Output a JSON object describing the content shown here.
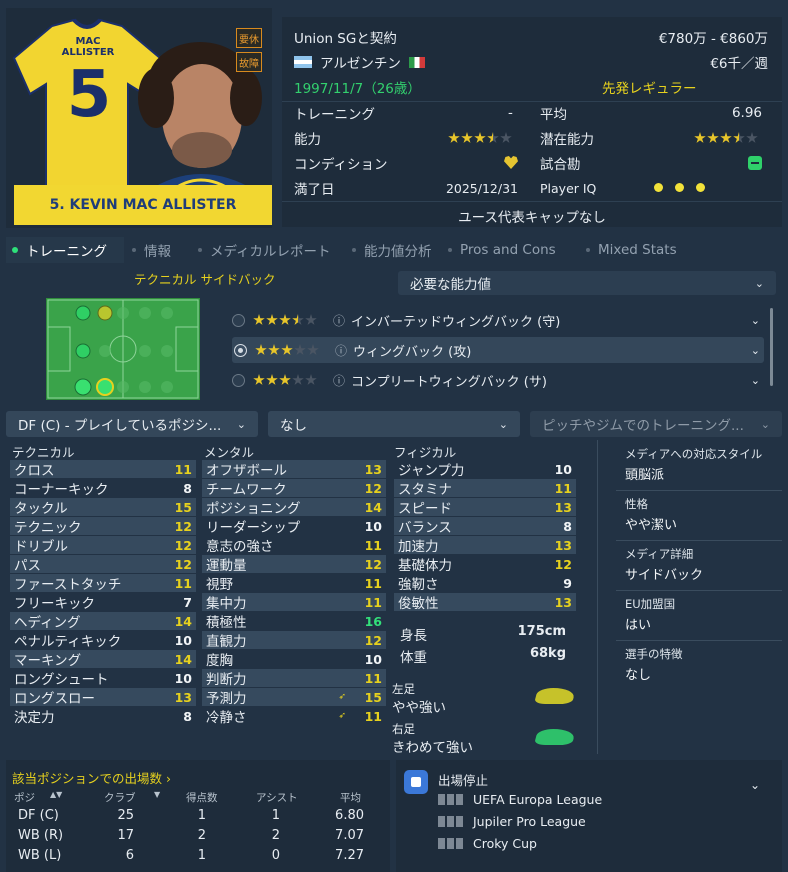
{
  "player": {
    "shirt_name": "MAC ALLISTER",
    "shirt_number": "5",
    "name_bar": "5. KEVIN MAC ALLISTER",
    "tags": [
      "要休",
      "故障"
    ]
  },
  "info": {
    "contract": "Union SGと契約",
    "value": "€780万 - €860万",
    "nationality": "アルゼンチン",
    "wage": "€6千／週",
    "birth": "1997/11/7（26歳）",
    "squad_status": "先発レギュラー",
    "training_label": "トレーニング",
    "training_value": "-",
    "avg_label": "平均",
    "avg_value": "6.96",
    "ability_label": "能力",
    "ability_stars": 3.5,
    "potential_label": "潜在能力",
    "potential_stars": 3.5,
    "condition_label": "コンディション",
    "match_fit_label": "試合勘",
    "expires_label": "満了日",
    "expires_value": "2025/12/31",
    "iq_label": "Player IQ",
    "youth_caps": "ユース代表キャップなし"
  },
  "tabs": [
    "トレーニング",
    "情報",
    "メディカルレポート",
    "能力値分析",
    "Pros and Cons",
    "Mixed Stats"
  ],
  "position_title": "テクニカル サイドバック",
  "required_attr_dropdown": "必要な能力値",
  "roles": [
    {
      "stars": 3.5,
      "label": "インバーテッドウィングバック (守)",
      "selected": false
    },
    {
      "stars": 3,
      "label": "ウィングバック (攻)",
      "selected": true
    },
    {
      "stars": 3,
      "label": "コンプリートウィングバック (サ)",
      "selected": false
    }
  ],
  "filters": {
    "position": "DF (C) - プレイしているポジシ...",
    "none": "なし",
    "training_placeholder": "ピッチやジムでのトレーニング..."
  },
  "attributes": {
    "technical_header": "テクニカル",
    "mental_header": "メンタル",
    "physical_header": "フィジカル",
    "technical": [
      {
        "name": "クロス",
        "value": "11"
      },
      {
        "name": "コーナーキック",
        "value": "8"
      },
      {
        "name": "タックル",
        "value": "15"
      },
      {
        "name": "テクニック",
        "value": "12"
      },
      {
        "name": "ドリブル",
        "value": "12"
      },
      {
        "name": "パス",
        "value": "12"
      },
      {
        "name": "ファーストタッチ",
        "value": "11"
      },
      {
        "name": "フリーキック",
        "value": "7"
      },
      {
        "name": "ヘディング",
        "value": "14"
      },
      {
        "name": "ペナルティキック",
        "value": "10"
      },
      {
        "name": "マーキング",
        "value": "14"
      },
      {
        "name": "ロングシュート",
        "value": "10"
      },
      {
        "name": "ロングスロー",
        "value": "13"
      },
      {
        "name": "決定力",
        "value": "8"
      }
    ],
    "mental": [
      {
        "name": "オフザボール",
        "value": "13"
      },
      {
        "name": "チームワーク",
        "value": "12"
      },
      {
        "name": "ポジショニング",
        "value": "14"
      },
      {
        "name": "リーダーシップ",
        "value": "10"
      },
      {
        "name": "意志の強さ",
        "value": "11"
      },
      {
        "name": "運動量",
        "value": "12"
      },
      {
        "name": "視野",
        "value": "11"
      },
      {
        "name": "集中力",
        "value": "11"
      },
      {
        "name": "積極性",
        "value": "16"
      },
      {
        "name": "直観力",
        "value": "12"
      },
      {
        "name": "度胸",
        "value": "10"
      },
      {
        "name": "判断力",
        "value": "11"
      },
      {
        "name": "予測力",
        "value": "15"
      },
      {
        "name": "冷静さ",
        "value": "11"
      }
    ],
    "physical": [
      {
        "name": "ジャンプ力",
        "value": "10"
      },
      {
        "name": "スタミナ",
        "value": "11"
      },
      {
        "name": "スピード",
        "value": "13"
      },
      {
        "name": "バランス",
        "value": "8"
      },
      {
        "name": "加速力",
        "value": "13"
      },
      {
        "name": "基礎体力",
        "value": "12"
      },
      {
        "name": "強靭さ",
        "value": "9"
      },
      {
        "name": "俊敏性",
        "value": "13"
      }
    ],
    "height_label": "身長",
    "height_value": "175cm",
    "weight_label": "体重",
    "weight_value": "68kg",
    "left_foot_label": "左足",
    "left_foot_value": "やや強い",
    "right_foot_label": "右足",
    "right_foot_value": "きわめて強い"
  },
  "side_info": [
    {
      "label": "メディアへの対応スタイル",
      "value": "頭脳派"
    },
    {
      "label": "性格",
      "value": "やや潔い"
    },
    {
      "label": "メディア詳細",
      "value": "サイドバック"
    },
    {
      "label": "EU加盟国",
      "value": "はい"
    },
    {
      "label": "選手の特徴",
      "value": "なし"
    }
  ],
  "appearances": {
    "title": "該当ポジションでの出場数 ›",
    "headers": [
      "ポジ",
      "クラブ",
      "得点数",
      "アシスト",
      "平均"
    ],
    "rows": [
      {
        "pos": "DF (C)",
        "apps": "25",
        "goals": "1",
        "assists": "1",
        "avg": "6.80"
      },
      {
        "pos": "WB (R)",
        "apps": "17",
        "goals": "2",
        "assists": "2",
        "avg": "7.07"
      },
      {
        "pos": "WB (L)",
        "apps": "6",
        "goals": "1",
        "assists": "0",
        "avg": "7.27"
      }
    ]
  },
  "suspension": {
    "title": "出場停止",
    "competitions": [
      "UEFA Europa League",
      "Jupiler Pro League",
      "Croky Cup"
    ]
  }
}
